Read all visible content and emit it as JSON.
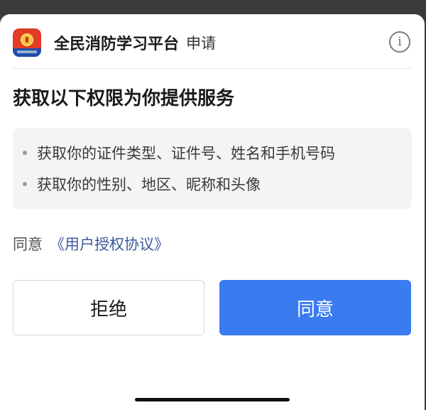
{
  "header": {
    "app_name": "全民消防学习平台",
    "apply_label": "申请",
    "info_icon": "info-icon",
    "logo_icon": "fire-emblem-logo"
  },
  "title": "获取以下权限为你提供服务",
  "permissions": [
    "获取你的证件类型、证件号、姓名和手机号码",
    "获取你的性别、地区、昵称和头像"
  ],
  "agreement": {
    "prefix": "同意",
    "link_text": "《用户授权协议》"
  },
  "buttons": {
    "reject_label": "拒绝",
    "agree_label": "同意"
  },
  "colors": {
    "accent": "#3a7bf0",
    "link": "#3d5a9c",
    "logo_red": "#e23b26",
    "logo_blue": "#1f4ea8"
  }
}
